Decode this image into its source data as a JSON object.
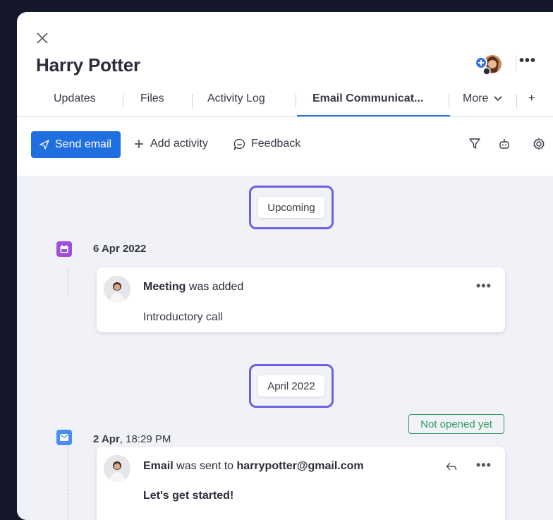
{
  "header": {
    "title": "Harry Potter",
    "more_icon": "dots-horizontal-icon",
    "close_icon": "close-icon"
  },
  "tabs": [
    {
      "label": "Updates"
    },
    {
      "label": "Files"
    },
    {
      "label": "Activity Log"
    },
    {
      "label": "Email Communicat...",
      "active": true
    },
    {
      "label": "More"
    },
    {
      "label": "+"
    }
  ],
  "toolbar": {
    "send_email": "Send email",
    "add_activity": "Add activity",
    "feedback": "Feedback",
    "icons": [
      "filter-icon",
      "robot-icon",
      "settings-icon"
    ]
  },
  "feed": {
    "groups": [
      {
        "label": "Upcoming",
        "events": [
          {
            "type": "meeting",
            "icon": "calendar-icon",
            "icon_color": "#9d50dd",
            "date": "6 Apr 2022",
            "time": "",
            "head_bold": "Meeting",
            "head_rest": " was added",
            "body": "Introductory call"
          }
        ]
      },
      {
        "label": "April 2022",
        "events": [
          {
            "type": "email",
            "icon": "mail-icon",
            "icon_color": "#4a8ef5",
            "date": "2 Apr",
            "time": ", 18:29 PM",
            "status": "Not opened yet",
            "head_bold": "Email",
            "head_rest": " was sent to ",
            "head_email": "harrypotter@gmail.com",
            "body": "Let's get started!"
          }
        ]
      }
    ]
  },
  "colors": {
    "accent": "#1f6fe0",
    "highlight": "#6b60e8",
    "status_green": "#2e9b5b",
    "backdrop": "#15172b"
  }
}
